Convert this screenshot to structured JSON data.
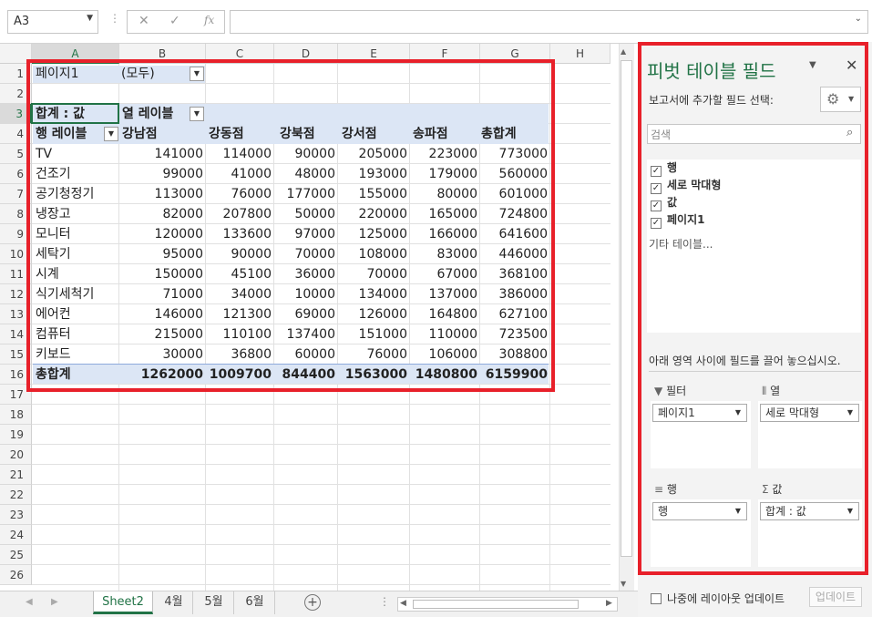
{
  "formula_bar": {
    "name_box": "A3",
    "cancel_icon": "✕",
    "enter_icon": "✓",
    "fx_label": "fx",
    "content": ""
  },
  "columns": [
    "A",
    "B",
    "C",
    "D",
    "E",
    "F",
    "G",
    "H"
  ],
  "rows": [
    "1",
    "2",
    "3",
    "4",
    "5",
    "6",
    "7",
    "8",
    "9",
    "10",
    "11",
    "12",
    "13",
    "14",
    "15",
    "16",
    "17",
    "18",
    "19",
    "20",
    "21",
    "22",
    "23",
    "24",
    "25",
    "26"
  ],
  "pivot": {
    "filter_label": "페이지1",
    "filter_value": "(모두)",
    "values_label": "합계 : 값",
    "column_labels_caption": "열 레이블",
    "row_labels_caption": "행 레이블",
    "column_headers": [
      "강남점",
      "강동점",
      "강북점",
      "강서점",
      "송파점",
      "총합계"
    ],
    "rows": [
      {
        "label": "TV",
        "values": [
          "141000",
          "114000",
          "90000",
          "205000",
          "223000",
          "773000"
        ]
      },
      {
        "label": "건조기",
        "values": [
          "99000",
          "41000",
          "48000",
          "193000",
          "179000",
          "560000"
        ]
      },
      {
        "label": "공기청정기",
        "values": [
          "113000",
          "76000",
          "177000",
          "155000",
          "80000",
          "601000"
        ]
      },
      {
        "label": "냉장고",
        "values": [
          "82000",
          "207800",
          "50000",
          "220000",
          "165000",
          "724800"
        ]
      },
      {
        "label": "모니터",
        "values": [
          "120000",
          "133600",
          "97000",
          "125000",
          "166000",
          "641600"
        ]
      },
      {
        "label": "세탁기",
        "values": [
          "95000",
          "90000",
          "70000",
          "108000",
          "83000",
          "446000"
        ]
      },
      {
        "label": "시계",
        "values": [
          "150000",
          "45100",
          "36000",
          "70000",
          "67000",
          "368100"
        ]
      },
      {
        "label": "식기세척기",
        "values": [
          "71000",
          "34000",
          "10000",
          "134000",
          "137000",
          "386000"
        ]
      },
      {
        "label": "에어컨",
        "values": [
          "146000",
          "121300",
          "69000",
          "126000",
          "164800",
          "627100"
        ]
      },
      {
        "label": "컴퓨터",
        "values": [
          "215000",
          "110100",
          "137400",
          "151000",
          "110000",
          "723500"
        ]
      },
      {
        "label": "키보드",
        "values": [
          "30000",
          "36800",
          "60000",
          "76000",
          "106000",
          "308800"
        ]
      }
    ],
    "grand_total": {
      "label": "총합계",
      "values": [
        "1262000",
        "1009700",
        "844400",
        "1563000",
        "1480800",
        "6159900"
      ]
    }
  },
  "sheet_tabs": [
    "Sheet2",
    "4월",
    "5월",
    "6월"
  ],
  "active_tab": "Sheet2",
  "pane": {
    "title": "피벗 테이블 필드",
    "subtitle": "보고서에 추가할 필드 선택:",
    "search_placeholder": "검색",
    "fields": [
      "행",
      "세로 막대형",
      "값",
      "페이지1"
    ],
    "more_tables": "기타 테이블...",
    "drag_hint": "아래 영역 사이에 필드를 끌어 놓으십시오.",
    "zones": {
      "filter": {
        "label": "필터",
        "item": "페이지1"
      },
      "columns": {
        "label": "열",
        "item": "세로 막대형"
      },
      "rows": {
        "label": "행",
        "item": "행"
      },
      "values": {
        "label": "값",
        "item": "합계 : 값"
      }
    },
    "defer_label": "나중에 레이아웃 업데이트",
    "update_button": "업데이트"
  }
}
